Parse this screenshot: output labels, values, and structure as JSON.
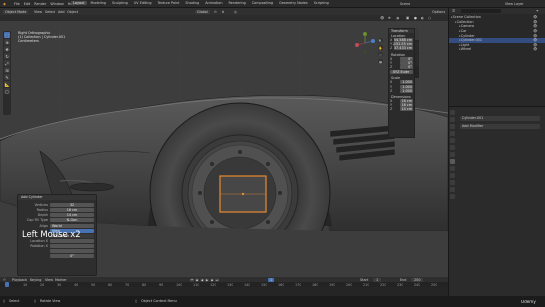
{
  "topbar": {
    "menus": [
      "File",
      "Edit",
      "Render",
      "Window",
      "Help"
    ],
    "workspaces": [
      "Layout",
      "Modeling",
      "Sculpting",
      "UV Editing",
      "Texture Paint",
      "Shading",
      "Animation",
      "Rendering",
      "Compositing",
      "Geometry Nodes",
      "Scripting"
    ],
    "active_workspace": "Layout",
    "scene": "Scene",
    "view_layer": "View Layer"
  },
  "viewport_header": {
    "mode": "Object Mode",
    "menus": [
      "View",
      "Select",
      "Add",
      "Object"
    ],
    "orientation": "Global",
    "options": "Options"
  },
  "viewport_info": [
    "Right Orthographic",
    "(1) Collection | Cylinder.001",
    "Centimeters"
  ],
  "npanel": {
    "title": "Transform",
    "location_label": "Location",
    "location": [
      "X",
      "Y",
      "Z"
    ],
    "location_values": [
      "54.588 cm",
      "-152.55 cm",
      "37.433 cm"
    ],
    "rotation_label": "Rotation",
    "rotation": [
      "X",
      "Y",
      "Z"
    ],
    "rotation_values": [
      "0°",
      "0°",
      "0°"
    ],
    "mode_label": "XYZ Euler",
    "scale_label": "Scale",
    "scale_values": [
      "1.000",
      "1.000",
      "1.000"
    ],
    "dimensions_label": "Dimensions",
    "dimensions_values": [
      "16 cm",
      "16 cm",
      "14 cm"
    ],
    "tabs": [
      "Item",
      "Tool",
      "View"
    ]
  },
  "redo_panel": {
    "title": "Add Cylinder",
    "rows": [
      {
        "label": "Vertices",
        "value": "32"
      },
      {
        "label": "Radius",
        "value": "16 cm"
      },
      {
        "label": "Depth",
        "value": "14 cm"
      },
      {
        "label": "Cap Fill Type",
        "value": "N-Gon"
      }
    ],
    "align_label": "Align",
    "align_options": [
      "World",
      "View",
      "3D Cursor"
    ],
    "align_selected": "View",
    "location_label": "Location X",
    "rotation_label": "Rotation X",
    "rotation_values": [
      "",
      "",
      "0°"
    ]
  },
  "overlay_text": "Left Mouse x2",
  "outliner": {
    "rows": [
      {
        "label": "Scene Collection",
        "selected": false
      },
      {
        "label": "Collection",
        "selected": false
      },
      {
        "label": "Camera",
        "selected": false
      },
      {
        "label": "Car",
        "selected": false
      },
      {
        "label": "Cylinder",
        "selected": false
      },
      {
        "label": "Cylinder.001",
        "selected": true
      },
      {
        "label": "Light",
        "selected": false
      },
      {
        "label": "Wheel",
        "selected": false
      }
    ]
  },
  "properties": {
    "object_name": "Cylinder.001",
    "add_modifier": "Add Modifier"
  },
  "timeline": {
    "menus": [
      "Playback",
      "Keying",
      "View",
      "Marker"
    ],
    "current_frame": "1",
    "start_label": "Start",
    "start": "1",
    "end_label": "End",
    "end": "250",
    "ruler": [
      "0",
      "10",
      "20",
      "30",
      "40",
      "50",
      "60",
      "70",
      "80",
      "90",
      "100",
      "110",
      "120",
      "130",
      "140",
      "150",
      "160",
      "170",
      "180",
      "190",
      "200",
      "210",
      "220",
      "230",
      "240",
      "250"
    ]
  },
  "statusbar": {
    "left": "Select",
    "middle_left": "Rotate View",
    "middle": "Object Context Menu",
    "brand": "Udemy"
  },
  "colors": {
    "accent": "#4772b3",
    "selection": "#e88a2e",
    "viewport_bg": "#3d3d3d"
  }
}
